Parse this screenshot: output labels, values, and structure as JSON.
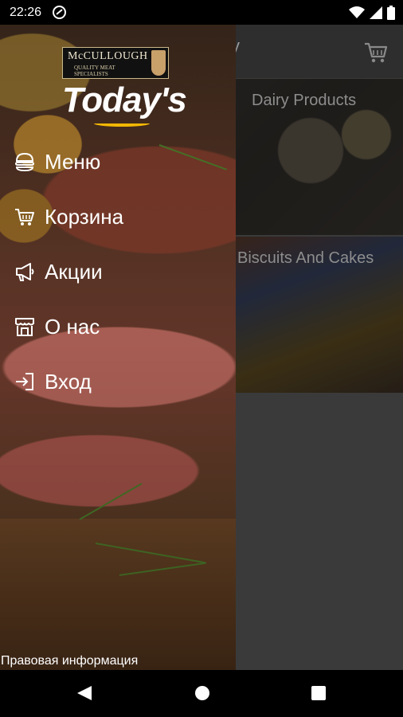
{
  "status_bar": {
    "time": "22:26",
    "icons": [
      "sync-disabled-icon",
      "wifi-icon",
      "cellular-icon",
      "battery-icon"
    ]
  },
  "app": {
    "header_title_partial": "y",
    "cart_icon": "cart-icon",
    "categories": [
      {
        "label": "Dairy Products"
      },
      {
        "label": "Biscuits And Cakes"
      }
    ]
  },
  "drawer": {
    "logo": {
      "brand": "McCULLOUGH",
      "tagline": "QUALITY MEAT SPECIALISTS",
      "name": "Today's"
    },
    "menu": [
      {
        "label": "Меню",
        "icon": "burger-icon"
      },
      {
        "label": "Корзина",
        "icon": "cart-icon"
      },
      {
        "label": "Акции",
        "icon": "megaphone-icon"
      },
      {
        "label": "О нас",
        "icon": "store-icon"
      },
      {
        "label": "Вход",
        "icon": "login-icon"
      }
    ],
    "legal_link": "Правовая информация"
  },
  "nav_bar": {
    "buttons": [
      "back-icon",
      "home-icon",
      "recents-icon"
    ]
  },
  "colors": {
    "accent": "#f2b705",
    "drawer_text": "#ffffff",
    "scrim": "#3a3a3a"
  }
}
